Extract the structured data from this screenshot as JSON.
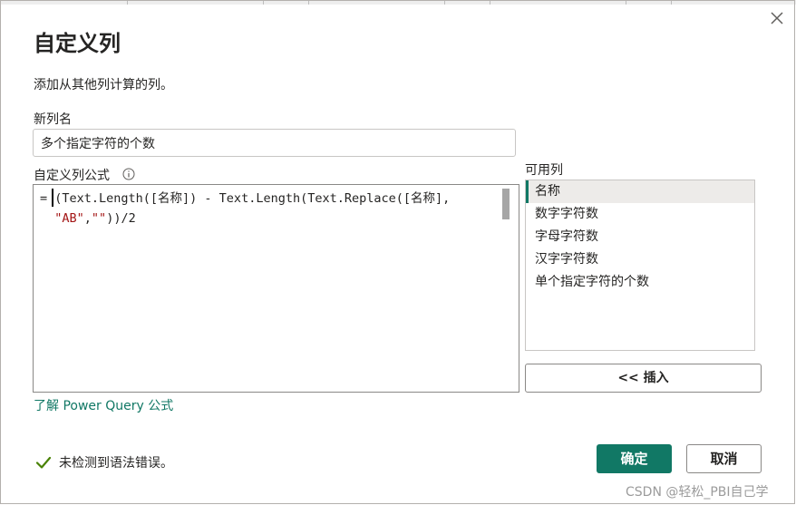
{
  "dialog": {
    "title": "自定义列",
    "description": "添加从其他列计算的列。",
    "new_column_label": "新列名",
    "new_column_value": "多个指定字符的个数",
    "formula_label": "自定义列公式",
    "formula": {
      "line1_prefix": "= (Text.Length([名称]) - Text.Length(Text.Replace([名称],",
      "line2_str1": "\"AB\"",
      "line2_comma": ",",
      "line2_str2": "\"\"",
      "line2_suffix": "))/2"
    },
    "available_columns_label": "可用列",
    "available_columns": [
      "名称",
      "数字字符数",
      "字母字符数",
      "汉字字符数",
      "单个指定字符的个数"
    ],
    "insert_button": "<< 插入",
    "learn_link": "了解 Power Query 公式",
    "status_text": "未检测到语法错误。",
    "ok_button": "确定",
    "cancel_button": "取消"
  },
  "watermark": "CSDN @轻松_PBI自己学",
  "colors": {
    "accent": "#117865",
    "selected_bg": "#edebe9"
  },
  "icons": {
    "close": "close-icon",
    "info": "info-icon",
    "check": "checkmark-icon"
  }
}
